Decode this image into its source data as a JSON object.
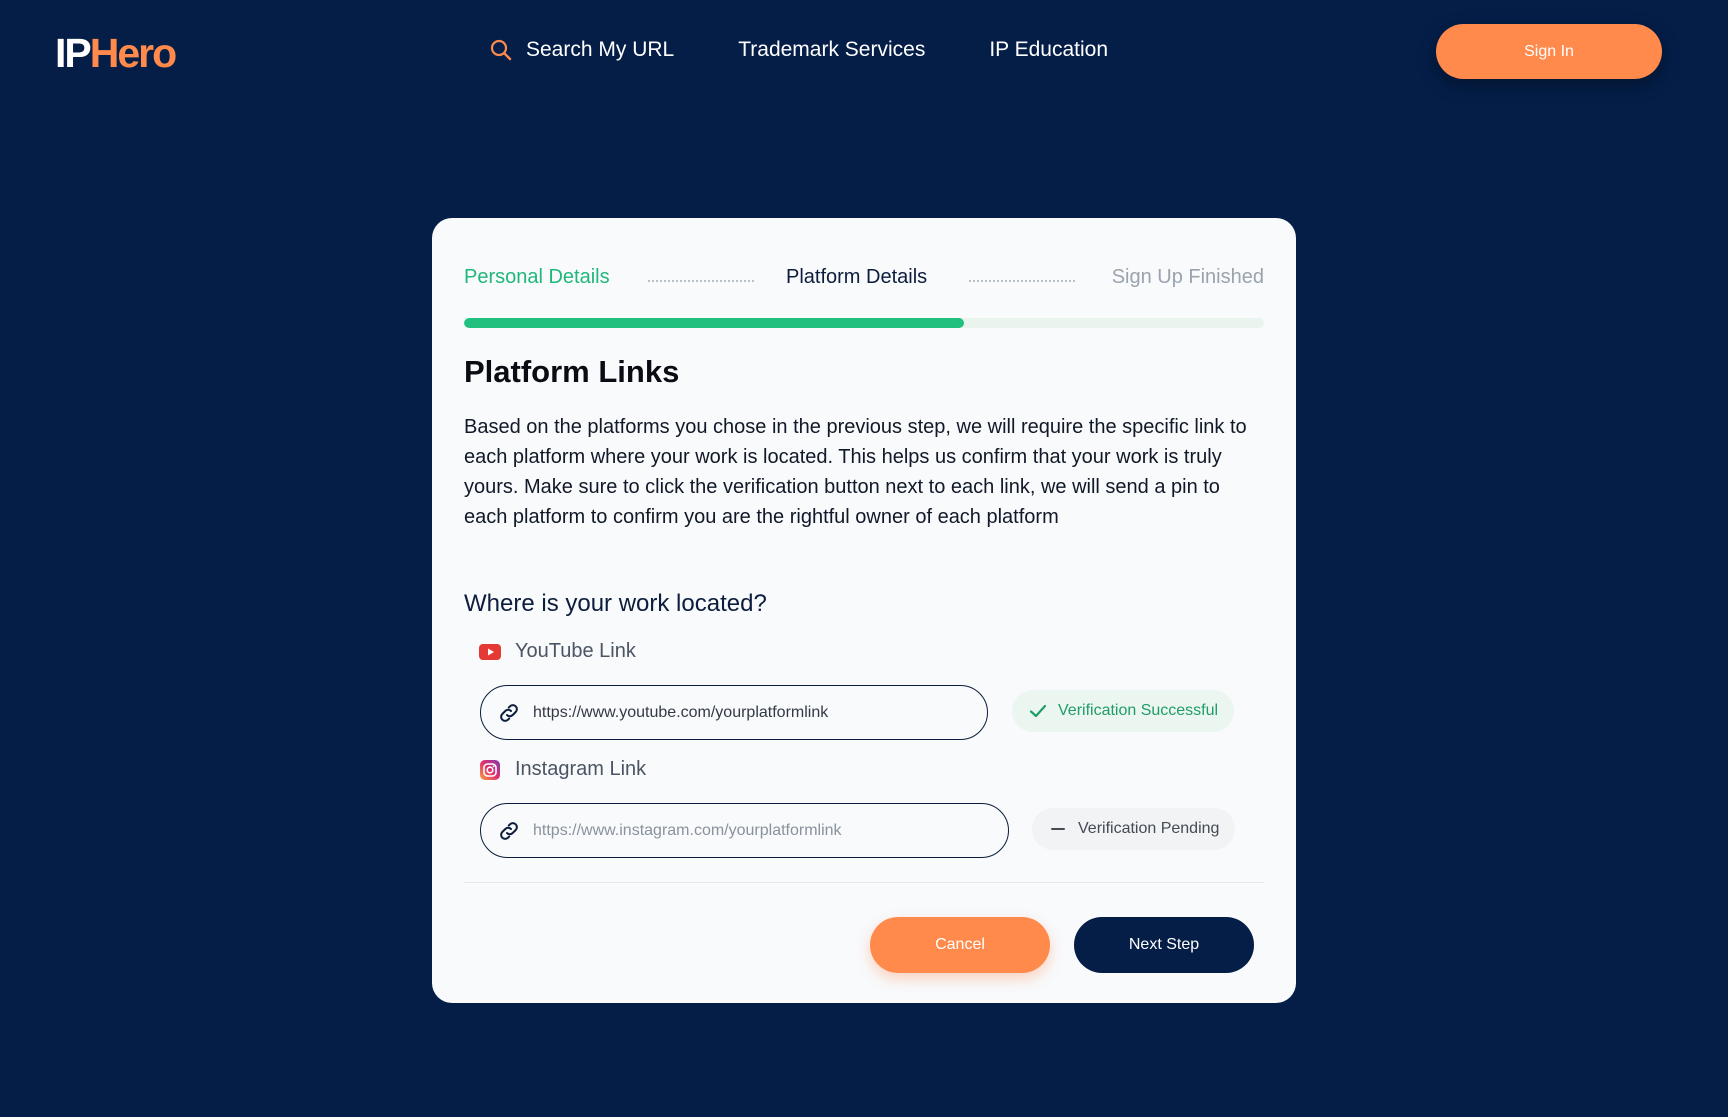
{
  "brand": {
    "logo_part1": "IP",
    "logo_part2": "Hero",
    "accent": "#ff8a4c",
    "background": "#041e48"
  },
  "nav": {
    "search_label": "Search My URL",
    "trademark_label": "Trademark Services",
    "education_label": "IP Education",
    "signin_label": "Sign In"
  },
  "steps": {
    "items": [
      {
        "label": "Personal Details",
        "state": "complete"
      },
      {
        "label": "Platform Details",
        "state": "current"
      },
      {
        "label": "Sign Up Finished",
        "state": "upcoming"
      }
    ],
    "progress_fraction": 0.625,
    "progress_color": "#22c07f"
  },
  "form": {
    "title": "Platform Links",
    "description": "Based on the platforms you chose in the previous step, we will require the specific link to each platform where your work is located. This helps us confirm that your work is truly yours. Make sure to click the verification button next to each link, we will send a pin to each platform to confirm you are the rightful owner of each platform",
    "question": "Where is your work located?",
    "youtube": {
      "label": "YouTube Link",
      "icon": "youtube-icon",
      "value": "https://www.youtube.com/yourplatformlink",
      "status": "Verification Successful",
      "status_icon": "check-icon"
    },
    "instagram": {
      "label": "Instagram Link",
      "icon": "instagram-icon",
      "placeholder": "https://www.instagram.com/yourplatformlink",
      "status": "Verification Pending",
      "status_icon": "minus-icon"
    }
  },
  "actions": {
    "cancel_label": "Cancel",
    "next_label": "Next Step"
  }
}
